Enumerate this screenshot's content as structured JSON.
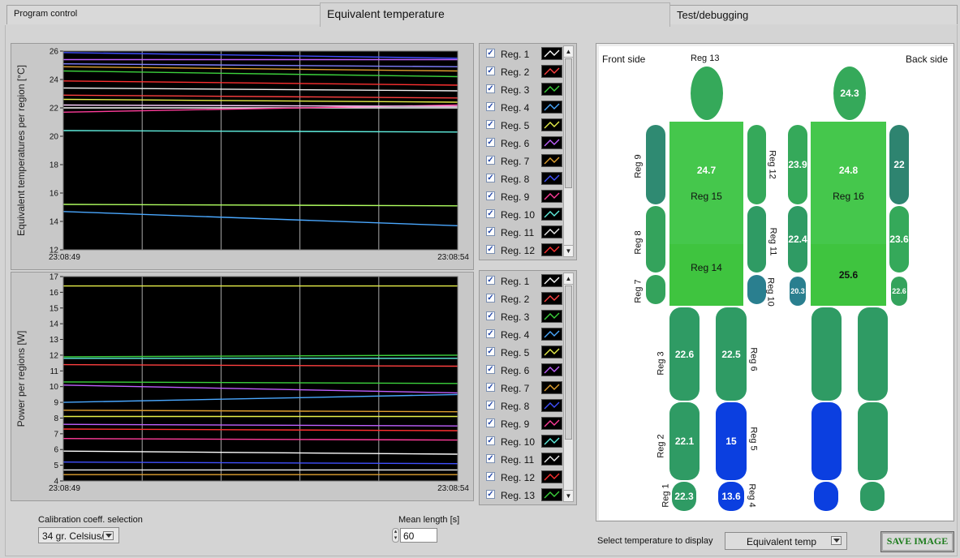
{
  "tabs": [
    {
      "label": "Program control"
    },
    {
      "label": "Equivalent temperature"
    },
    {
      "label": "Test/debugging"
    }
  ],
  "colors": {
    "map_green": "#2f9b64",
    "map_light_green": "#45c74c",
    "map_mid_green": "#35a95a",
    "map_blue": "#0b3fe0",
    "map_teal": "#2a7f8f",
    "plot_bg": "#000000",
    "grid": "#a8a8a8"
  },
  "chart_data": [
    {
      "type": "line",
      "ylabel": "Equivalent temperatures per region [°C]",
      "ylim": [
        12,
        26
      ],
      "yticks": [
        12,
        14,
        16,
        18,
        20,
        22,
        24,
        26
      ],
      "x_start_label": "23:08:49",
      "x_end_label": "23:08:54",
      "grid": true,
      "series": [
        {
          "color": "#ffffff",
          "values": [
            22.0,
            22.0
          ]
        },
        {
          "color": "#ff4040",
          "values": [
            22.9,
            22.7
          ]
        },
        {
          "color": "#3cd23c",
          "values": [
            24.6,
            24.2
          ]
        },
        {
          "color": "#4aa8ff",
          "values": [
            14.7,
            13.7
          ]
        },
        {
          "color": "#e8f04a",
          "values": [
            22.6,
            22.4
          ]
        },
        {
          "color": "#c060ff",
          "values": [
            25.4,
            25.4
          ]
        },
        {
          "color": "#e0a030",
          "values": [
            24.9,
            24.6
          ]
        },
        {
          "color": "#4050ff",
          "values": [
            25.9,
            25.5
          ]
        },
        {
          "color": "#ff3c9a",
          "values": [
            21.7,
            22.2
          ]
        },
        {
          "color": "#60f0e0",
          "values": [
            20.4,
            20.3
          ]
        },
        {
          "color": "#f0f0f0",
          "values": [
            23.4,
            23.2
          ]
        },
        {
          "color": "#ff3030",
          "values": [
            23.9,
            23.6
          ]
        },
        {
          "color": "#b0ff60",
          "values": [
            15.2,
            15.1
          ]
        },
        {
          "color": "#8080ff",
          "values": [
            25.1,
            24.9
          ]
        },
        {
          "color": "#ffd0ff",
          "values": [
            22.2,
            22.1
          ]
        }
      ]
    },
    {
      "type": "line",
      "ylabel": "Power per regions [W]",
      "ylim": [
        4,
        17
      ],
      "yticks": [
        4,
        5,
        6,
        7,
        8,
        9,
        10,
        11,
        12,
        13,
        14,
        15,
        16,
        17
      ],
      "x_start_label": "23:08:49",
      "x_end_label": "23:08:54",
      "grid": true,
      "series": [
        {
          "color": "#ffffff",
          "values": [
            5.9,
            5.7
          ]
        },
        {
          "color": "#ff4040",
          "values": [
            11.4,
            11.3
          ]
        },
        {
          "color": "#3cd23c",
          "values": [
            10.3,
            10.2
          ]
        },
        {
          "color": "#4aa8ff",
          "values": [
            9.0,
            9.5
          ]
        },
        {
          "color": "#e8f04a",
          "values": [
            8.1,
            8.1
          ]
        },
        {
          "color": "#c060ff",
          "values": [
            10.1,
            9.6
          ]
        },
        {
          "color": "#e0a030",
          "values": [
            4.4,
            4.4
          ]
        },
        {
          "color": "#4050ff",
          "values": [
            5.2,
            5.1
          ]
        },
        {
          "color": "#ff3c9a",
          "values": [
            6.7,
            6.6
          ]
        },
        {
          "color": "#60f0e0",
          "values": [
            11.8,
            11.8
          ]
        },
        {
          "color": "#f0f0f0",
          "values": [
            4.7,
            4.7
          ]
        },
        {
          "color": "#ff3030",
          "values": [
            7.3,
            7.2
          ]
        },
        {
          "color": "#3cd23c",
          "values": [
            11.9,
            12.0
          ]
        },
        {
          "color": "#e8f04a",
          "values": [
            16.4,
            16.4
          ]
        },
        {
          "color": "#c060ff",
          "values": [
            7.6,
            7.5
          ]
        },
        {
          "color": "#e0a030",
          "values": [
            8.5,
            8.4
          ]
        }
      ]
    }
  ],
  "legend_top": [
    {
      "label": "Reg. 1",
      "color": "#ffffff"
    },
    {
      "label": "Reg. 2",
      "color": "#ff4040"
    },
    {
      "label": "Reg. 3",
      "color": "#3cd23c"
    },
    {
      "label": "Reg. 4",
      "color": "#4aa8ff"
    },
    {
      "label": "Reg. 5",
      "color": "#e8f04a"
    },
    {
      "label": "Reg. 6",
      "color": "#c060ff"
    },
    {
      "label": "Reg. 7",
      "color": "#e0a030"
    },
    {
      "label": "Reg. 8",
      "color": "#4050ff"
    },
    {
      "label": "Reg. 9",
      "color": "#ff3c9a"
    },
    {
      "label": "Reg. 10",
      "color": "#60f0e0"
    },
    {
      "label": "Reg. 11",
      "color": "#f0f0f0"
    },
    {
      "label": "Reg. 12",
      "color": "#ff3030"
    }
  ],
  "legend_bot": [
    {
      "label": "Reg. 1",
      "color": "#ffffff"
    },
    {
      "label": "Reg. 2",
      "color": "#ff4040"
    },
    {
      "label": "Reg. 3",
      "color": "#3cd23c"
    },
    {
      "label": "Reg. 4",
      "color": "#4aa8ff"
    },
    {
      "label": "Reg. 5",
      "color": "#e8f04a"
    },
    {
      "label": "Reg. 6",
      "color": "#c060ff"
    },
    {
      "label": "Reg. 7",
      "color": "#e0a030"
    },
    {
      "label": "Reg. 8",
      "color": "#4050ff"
    },
    {
      "label": "Reg. 9",
      "color": "#ff3c9a"
    },
    {
      "label": "Reg. 10",
      "color": "#60f0e0"
    },
    {
      "label": "Reg. 11",
      "color": "#f0f0f0"
    },
    {
      "label": "Reg. 12",
      "color": "#ff3030"
    },
    {
      "label": "Reg. 13",
      "color": "#3cd23c"
    }
  ],
  "body_map": {
    "front_label": "Front side",
    "back_label": "Back side",
    "front": {
      "reg13_label": "Reg 13",
      "reg15_label": "Reg 15",
      "reg14_label": "Reg 14",
      "reg15_value": "24.7",
      "reg3_value": "22.6",
      "reg6_value": "22.5",
      "reg2_value": "22.1",
      "reg5_value": "15",
      "reg1_value": "22.3",
      "reg4_value": "13.6",
      "labels": {
        "reg9": "Reg 9",
        "reg8": "Reg 8",
        "reg7": "Reg 7",
        "reg12": "Reg 12",
        "reg11": "Reg 11",
        "reg10": "Reg 10",
        "reg3": "Reg 3",
        "reg6": "Reg 6",
        "reg2": "Reg 2",
        "reg5": "Reg 5",
        "reg1": "Reg 1",
        "reg4": "Reg 4"
      }
    },
    "back": {
      "head_value": "24.3",
      "reg16_label": "Reg 16",
      "torso_upper_value": "24.8",
      "torso_lower_value": "25.6",
      "left_upper_arm": "23.9",
      "right_upper_arm": "22",
      "left_forearm": "22.4",
      "right_forearm": "23.6",
      "left_hand": "20.3",
      "right_hand": "22.6"
    }
  },
  "controls": {
    "calib_label": "Calibration coeff. selection",
    "calib_value": "34 gr. Celsius/",
    "mean_label": "Mean length [s]",
    "mean_value": "60",
    "select_label": "Select temperature to display",
    "select_value": "Equivalent temp",
    "save_label": "SAVE IMAGE"
  }
}
